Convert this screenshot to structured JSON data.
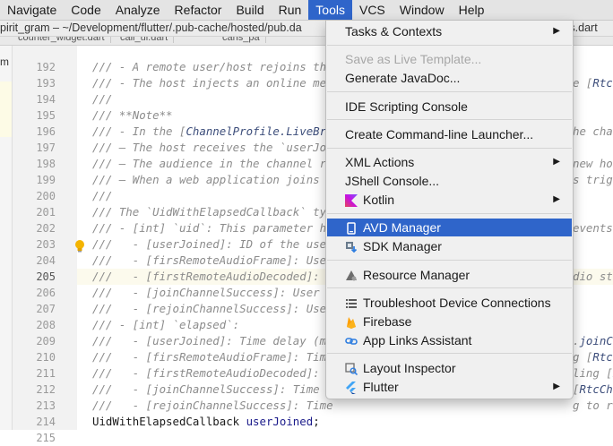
{
  "menubar": {
    "items": [
      "Navigate",
      "Code",
      "Analyze",
      "Refactor",
      "Build",
      "Run",
      "Tools",
      "VCS",
      "Window",
      "Help"
    ],
    "active": "Tools"
  },
  "titlebar": {
    "path": "pirit_gram – ~/Development/flutter/.pub-cache/hosted/pub.da",
    "right_fragment": "nts.dart"
  },
  "tabs": [
    "counter_widget.dart",
    "call_ui.dart",
    "cans_pa"
  ],
  "left_panel": {
    "label": "m"
  },
  "editor": {
    "current_line": 205,
    "lines": [
      {
        "n": 192,
        "text": "/// - A remote user/host rejoins the"
      },
      {
        "n": 193,
        "text": "/// - The host injects an online medi"
      },
      {
        "n": 194,
        "text": "///"
      },
      {
        "n": 195,
        "text": "/// **Note**"
      },
      {
        "n": 196,
        "pre": "/// - In the [",
        "ref": "ChannelProfile.LiveBroa",
        "post": ""
      },
      {
        "n": 197,
        "text": "/// — The host receives the `userJoi"
      },
      {
        "n": 198,
        "text": "/// — The audience in the channel re"
      },
      {
        "n": 199,
        "text": "/// — When a web application joins t"
      },
      {
        "n": 200,
        "text": "///"
      },
      {
        "n": 201,
        "text": "/// The `UidWithElapsedCallback` type"
      },
      {
        "n": 202,
        "text": "/// - [int] `uid`: This parameter has"
      },
      {
        "n": 203,
        "text": "///   - [userJoined]: ID of the user"
      },
      {
        "n": 204,
        "text": "///   - [firsRemoteAudioFrame]: User"
      },
      {
        "n": 205,
        "text": "///   - [firstRemoteAudioDecoded]: Us"
      },
      {
        "n": 206,
        "text": "///   - [joinChannelSuccess]: User ID"
      },
      {
        "n": 207,
        "text": "///   - [rejoinChannelSuccess]: User"
      },
      {
        "n": 208,
        "text": "/// - [int] `elapsed`:"
      },
      {
        "n": 209,
        "text": "///   - [userJoined]: Time delay (ms)"
      },
      {
        "n": 210,
        "text": "///   - [firsRemoteAudioFrame]: Time"
      },
      {
        "n": 211,
        "text": "///   - [firstRemoteAudioDecoded]: Ti"
      },
      {
        "n": 212,
        "text": "///   - [joinChannelSuccess]: Time el"
      },
      {
        "n": 213,
        "text": "///   - [rejoinChannelSuccess]: Time"
      },
      {
        "n": 214,
        "code_type": "UidWithElapsedCallback ",
        "code_fn": "userJoined",
        "code_end": ";"
      },
      {
        "n": 215,
        "text": ""
      }
    ],
    "right_fragments": [
      {
        "line": 193,
        "pre": "e [",
        "ref": "RtcE",
        "post": ""
      },
      {
        "line": 196,
        "text": "he chann"
      },
      {
        "line": 198,
        "text": "new ho"
      },
      {
        "line": 199,
        "text": "s trigg"
      },
      {
        "line": 202,
        "text": "events"
      },
      {
        "line": 205,
        "text": "dio str"
      },
      {
        "line": 209,
        "pre": ".",
        "ref": "joinCh",
        "post": ""
      },
      {
        "line": 210,
        "pre": "g [",
        "ref": "RtcE",
        "post": ""
      },
      {
        "line": 211,
        "pre": "ling [",
        "ref": "R",
        "post": ""
      },
      {
        "line": 212,
        "pre": "[",
        "ref": "RtcCha",
        "post": ""
      },
      {
        "line": 213,
        "text": "g to r"
      }
    ]
  },
  "tools_menu": {
    "items": [
      {
        "label": "Tasks & Contexts",
        "submenu": true
      },
      {
        "separator": true
      },
      {
        "label": "Save as Live Template...",
        "disabled": true
      },
      {
        "label": "Generate JavaDoc..."
      },
      {
        "separator": true
      },
      {
        "label": "IDE Scripting Console"
      },
      {
        "separator": true
      },
      {
        "label": "Create Command-line Launcher..."
      },
      {
        "separator": true
      },
      {
        "label": "XML Actions",
        "submenu": true
      },
      {
        "label": "JShell Console..."
      },
      {
        "label": "Kotlin",
        "icon": "kotlin-icon",
        "submenu": true
      },
      {
        "separator": true
      },
      {
        "label": "AVD Manager",
        "icon": "avd-manager-icon",
        "selected": true
      },
      {
        "label": "SDK Manager",
        "icon": "sdk-manager-icon"
      },
      {
        "separator": true
      },
      {
        "label": "Resource Manager",
        "icon": "resource-manager-icon"
      },
      {
        "separator": true
      },
      {
        "label": "Troubleshoot Device Connections",
        "icon": "list-icon"
      },
      {
        "label": "Firebase",
        "icon": "firebase-icon"
      },
      {
        "label": "App Links Assistant",
        "icon": "link-icon"
      },
      {
        "separator": true
      },
      {
        "label": "Layout Inspector",
        "icon": "layout-inspector-icon"
      },
      {
        "label": "Flutter",
        "icon": "flutter-icon",
        "submenu": true
      }
    ]
  },
  "colors": {
    "selection": "#2f65ca",
    "comment": "#8c8c8c",
    "doc_reference": "#3c4d7a",
    "current_line": "#fcfaed"
  }
}
